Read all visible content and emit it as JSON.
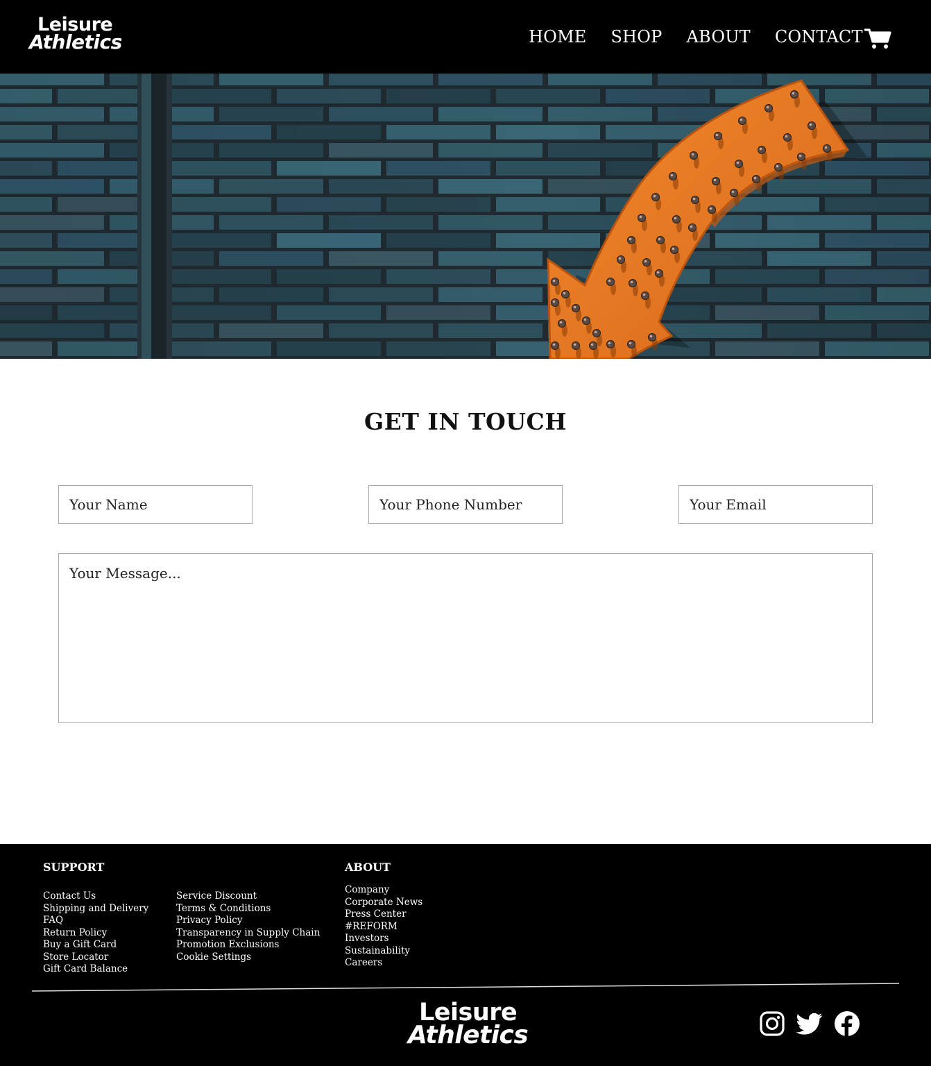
{
  "brand": {
    "line1": "Leisure",
    "line2": "Athletics"
  },
  "nav": {
    "items": [
      "HOME",
      "SHOP",
      "ABOUT",
      "CONTACT"
    ]
  },
  "icons": {
    "cart": "cart-icon",
    "instagram": "instagram-icon",
    "twitter": "twitter-icon",
    "facebook": "facebook-icon"
  },
  "colors": {
    "header_bg": "#000000",
    "accent": "#e8731e",
    "brick": "#2d3c46",
    "footer_bg": "#000000"
  },
  "contact": {
    "title": "GET IN TOUCH",
    "name_placeholder": "Your Name",
    "phone_placeholder": "Your Phone Number",
    "email_placeholder": "Your Email",
    "message_placeholder": "Your Message..."
  },
  "footer": {
    "support": {
      "heading": "SUPPORT",
      "col1": [
        "Contact Us",
        "Shipping and Delivery",
        "FAQ",
        "Return Policy",
        "Buy a Gift Card",
        "Store Locator",
        "Gift Card Balance"
      ],
      "col2": [
        "Service Discount",
        "Terms & Conditions",
        "Privacy Policy",
        "Transparency in Supply Chain",
        "Promotion Exclusions",
        "Cookie Settings"
      ]
    },
    "about": {
      "heading": "ABOUT",
      "items": [
        "Company",
        "Corporate News",
        "Press Center",
        "#REFORM",
        "Investors",
        "Sustainability",
        "Careers"
      ]
    }
  }
}
